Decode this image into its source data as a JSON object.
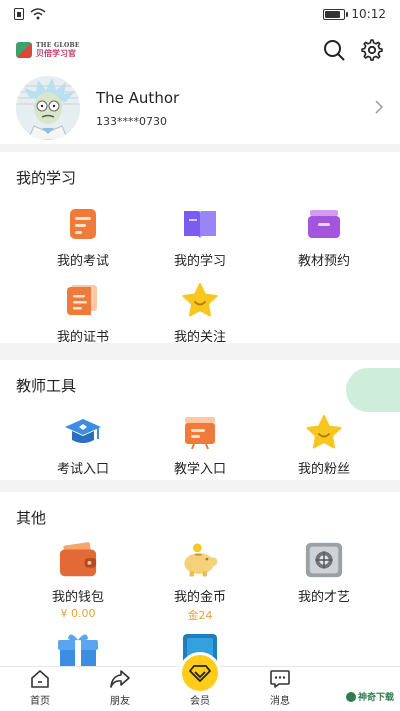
{
  "status_bar": {
    "time": "10:12"
  },
  "header": {
    "logo_en": "THE GLOBE",
    "logo_cn": "贝倍学习官"
  },
  "profile": {
    "name": "The Author",
    "phone": "133****0730"
  },
  "sections": {
    "study": {
      "title": "我的学习",
      "items": [
        "我的考试",
        "我的学习",
        "教材预约",
        "我的证书",
        "我的关注"
      ]
    },
    "teacher": {
      "title": "教师工具",
      "items": [
        "考试入口",
        "教学入口",
        "我的粉丝"
      ]
    },
    "other": {
      "title": "其他",
      "items": [
        "我的钱包",
        "我的金币",
        "我的才艺"
      ],
      "wallet_value": "¥ 0.00",
      "coin_value": "金24"
    }
  },
  "tabbar": {
    "tabs": [
      "首页",
      "朋友",
      "会员",
      "消息"
    ]
  },
  "watermark": "神奇下载",
  "colors": {
    "accent_orange": "#f07a3a",
    "accent_purple": "#7a5cf0",
    "accent_yellow": "#f7c61f",
    "accent_blue": "#3d8de0",
    "coin_gold": "#e0a634"
  }
}
